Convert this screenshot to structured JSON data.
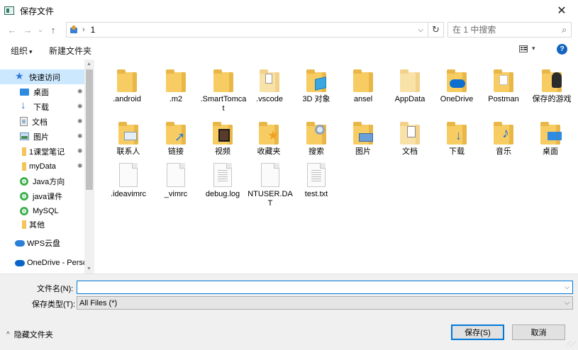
{
  "window": {
    "title": "保存文件"
  },
  "nav": {
    "back_glyph": "←",
    "forward_glyph": "→",
    "recent_glyph": "⌄",
    "up_glyph": "↑",
    "breadcrumb_sep": "›",
    "breadcrumb": "1",
    "refresh_glyph": "↻",
    "search_placeholder": "在 1 中搜索"
  },
  "toolbar": {
    "organize": "组织",
    "new_folder": "新建文件夹",
    "help": "?"
  },
  "sidebar": {
    "items": [
      {
        "label": "快速访问",
        "icon": "star-icon",
        "pinned": false
      },
      {
        "label": "桌面",
        "icon": "desktop-icon",
        "pinned": true
      },
      {
        "label": "下载",
        "icon": "download-icon",
        "pinned": true
      },
      {
        "label": "文档",
        "icon": "documents-icon",
        "pinned": true
      },
      {
        "label": "图片",
        "icon": "pictures-icon",
        "pinned": true
      },
      {
        "label": "1课堂笔记",
        "icon": "folder-icon",
        "pinned": true
      },
      {
        "label": "myData",
        "icon": "folder-icon",
        "pinned": true
      },
      {
        "label": "Java方向",
        "icon": "green-app-icon",
        "pinned": false
      },
      {
        "label": "java课件",
        "icon": "green-app-icon",
        "pinned": false
      },
      {
        "label": "MySQL",
        "icon": "green-app-icon",
        "pinned": false
      },
      {
        "label": "其他",
        "icon": "folder-icon",
        "pinned": false
      },
      {
        "label": "WPS云盘",
        "icon": "wps-cloud-icon",
        "pinned": false
      },
      {
        "label": "OneDrive - Perso",
        "icon": "onedrive-icon",
        "pinned": false
      }
    ]
  },
  "files": [
    {
      "name": ".android",
      "icon": "folder-icon"
    },
    {
      "name": ".m2",
      "icon": "folder-icon"
    },
    {
      "name": ".SmartTomcat",
      "icon": "folder-icon"
    },
    {
      "name": ".vscode",
      "icon": "folder-vscode-icon"
    },
    {
      "name": "3D 对象",
      "icon": "folder-3d-objects-icon"
    },
    {
      "name": "ansel",
      "icon": "folder-icon"
    },
    {
      "name": "AppData",
      "icon": "folder-hidden-icon"
    },
    {
      "name": "OneDrive",
      "icon": "folder-onedrive-icon"
    },
    {
      "name": "Postman",
      "icon": "folder-postman-icon"
    },
    {
      "name": "保存的游戏",
      "icon": "folder-saved-games-icon"
    },
    {
      "name": "联系人",
      "icon": "folder-contacts-icon"
    },
    {
      "name": "链接",
      "icon": "folder-links-icon"
    },
    {
      "name": "视频",
      "icon": "folder-videos-icon"
    },
    {
      "name": "收藏夹",
      "icon": "folder-favorites-icon"
    },
    {
      "name": "搜索",
      "icon": "folder-searches-icon"
    },
    {
      "name": "图片",
      "icon": "folder-pictures-icon"
    },
    {
      "name": "文档",
      "icon": "folder-documents-icon"
    },
    {
      "name": "下载",
      "icon": "folder-downloads-icon"
    },
    {
      "name": "音乐",
      "icon": "folder-music-icon"
    },
    {
      "name": "桌面",
      "icon": "folder-desktop-icon"
    },
    {
      "name": ".ideavimrc",
      "icon": "blank-file-icon"
    },
    {
      "name": "_vimrc",
      "icon": "blank-file-icon"
    },
    {
      "name": "debug.log",
      "icon": "text-file-icon"
    },
    {
      "name": "NTUSER.DAT",
      "icon": "blank-file-icon"
    },
    {
      "name": "test.txt",
      "icon": "text-file-icon"
    }
  ],
  "form": {
    "filename_label": "文件名(N):",
    "filename_value": "",
    "filetype_label": "保存类型(T):",
    "filetype_value": "All Files (*)",
    "hide_folders": "隐藏文件夹",
    "save": "保存(S)",
    "cancel": "取消"
  },
  "colors": {
    "selection": "#cce8ff",
    "accent": "#0078d7",
    "folder": "#f7cd63"
  }
}
